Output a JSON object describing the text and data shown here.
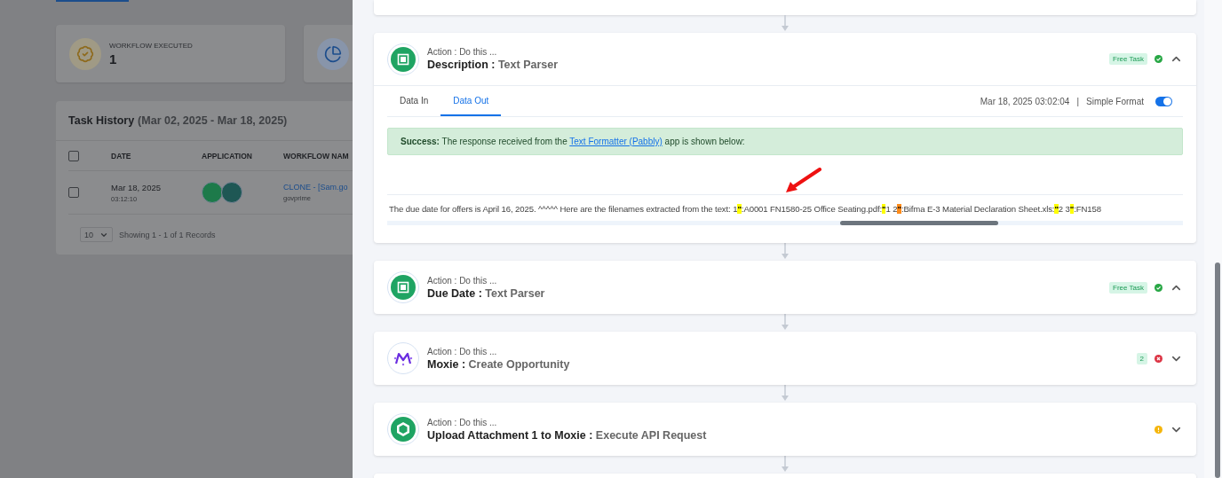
{
  "stats": [
    {
      "label": "WORKFLOW EXECUTED",
      "value": "1"
    }
  ],
  "task_history": {
    "title": "Task History",
    "range": "(Mar 02, 2025 - Mar 18, 2025)",
    "all_checked": false,
    "columns": [
      "DATE",
      "APPLICATION",
      "WORKFLOW NAM"
    ],
    "rows": [
      {
        "checked": false,
        "date": "Mar 18, 2025",
        "time": "03:12:10",
        "workflow": "CLONE - [Sam.go",
        "owner": "govprime"
      }
    ],
    "page_size": "10",
    "summary": "Showing 1 - 1 of 1 Records"
  },
  "steps": [
    {
      "kind": "success",
      "label": "Action : Do this ...",
      "app": "Description :",
      "action": "Text Parser",
      "badge": "Free Task",
      "expanded": true,
      "details": {
        "tabs": [
          {
            "label": "Data In",
            "selected": false
          },
          {
            "label": "Data Out",
            "selected": true
          }
        ],
        "timestamp": "Mar 18, 2025 03:02:04",
        "separator": "|",
        "format_label": "Simple Format",
        "simple_format": true,
        "alert": {
          "text": "**Success:** The response received from the ",
          "link": "Text Formatter (Pabbly)",
          "text_after": " app is shown below:"
        },
        "output": [
          {
            "text": "The due date for offers is April 16, 2025. ^^^^^ Here are the filenames extracted from the text: 1"
          },
          {
            "text": "\"",
            "color": "#ffff00"
          },
          {
            "text": ":A0001 FN1580-25 Office Seating.pdf:"
          },
          {
            "text": "\"",
            "color": "#ffff00"
          },
          {
            "text": "1 2"
          },
          {
            "text": "\"",
            "color": "#ff8c1a"
          },
          {
            "text": ":Bifma E-3 Material Declaration Sheet.xls:"
          },
          {
            "text": "\"",
            "color": "#ffff00"
          },
          {
            "text": "2 3"
          },
          {
            "text": "\"",
            "color": "#ffff00"
          },
          {
            "text": ":FN158"
          }
        ]
      }
    },
    {
      "kind": "success",
      "label": "Action : Do this ...",
      "app": "Due Date :",
      "action": "Text Parser",
      "badge": "Free Task",
      "expanded": true
    },
    {
      "kind": "error",
      "label": "Action : Do this ...",
      "app": "Moxie :",
      "action": "Create Opportunity",
      "badge": "2",
      "expanded": false
    },
    {
      "kind": "warning",
      "label": "Action : Do this ...",
      "app": "Upload Attachment 1 to Moxie :",
      "action": "Execute API Request",
      "expanded": false
    }
  ]
}
